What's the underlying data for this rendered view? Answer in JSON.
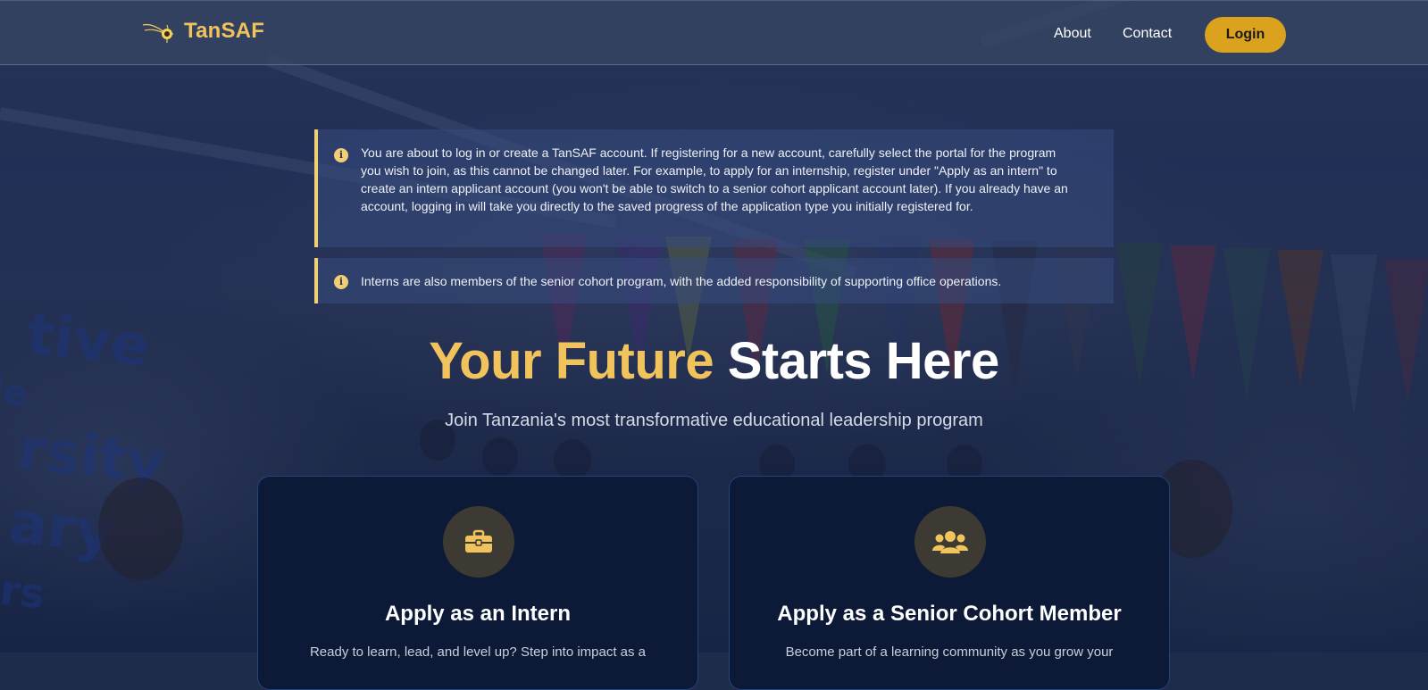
{
  "brand": {
    "name": "TanSAF",
    "logo_icon": "comet-icon",
    "accent_color": "#f0c35c",
    "button_color": "#dba21d"
  },
  "nav": {
    "about_label": "About",
    "contact_label": "Contact",
    "login_label": "Login"
  },
  "notices": [
    {
      "icon": "info-icon",
      "text": "You are about to log in or create a TanSAF account. If registering for a new account, carefully select the portal for the program you wish to join, as this cannot be changed later. For example, to apply for an internship, register under \"Apply as an intern\" to create an intern applicant account (you won't be able to switch to a senior cohort applicant account later). If you already have an account, logging in will take you directly to the saved progress of the application type you initially registered for."
    },
    {
      "icon": "info-icon",
      "text": "Interns are also members of the senior cohort program, with the added responsibility of supporting office operations."
    }
  ],
  "hero": {
    "title_accent": "Your Future",
    "title_rest": "Starts Here",
    "subtitle": "Join Tanzania's most transformative educational leadership program"
  },
  "cards": [
    {
      "icon": "briefcase-icon",
      "title": "Apply as an Intern",
      "description": "Ready to learn, lead, and level up? Step into impact as a"
    },
    {
      "icon": "users-icon",
      "title": "Apply as a Senior Cohort Member",
      "description": "Become part of a learning community as you grow your"
    }
  ]
}
